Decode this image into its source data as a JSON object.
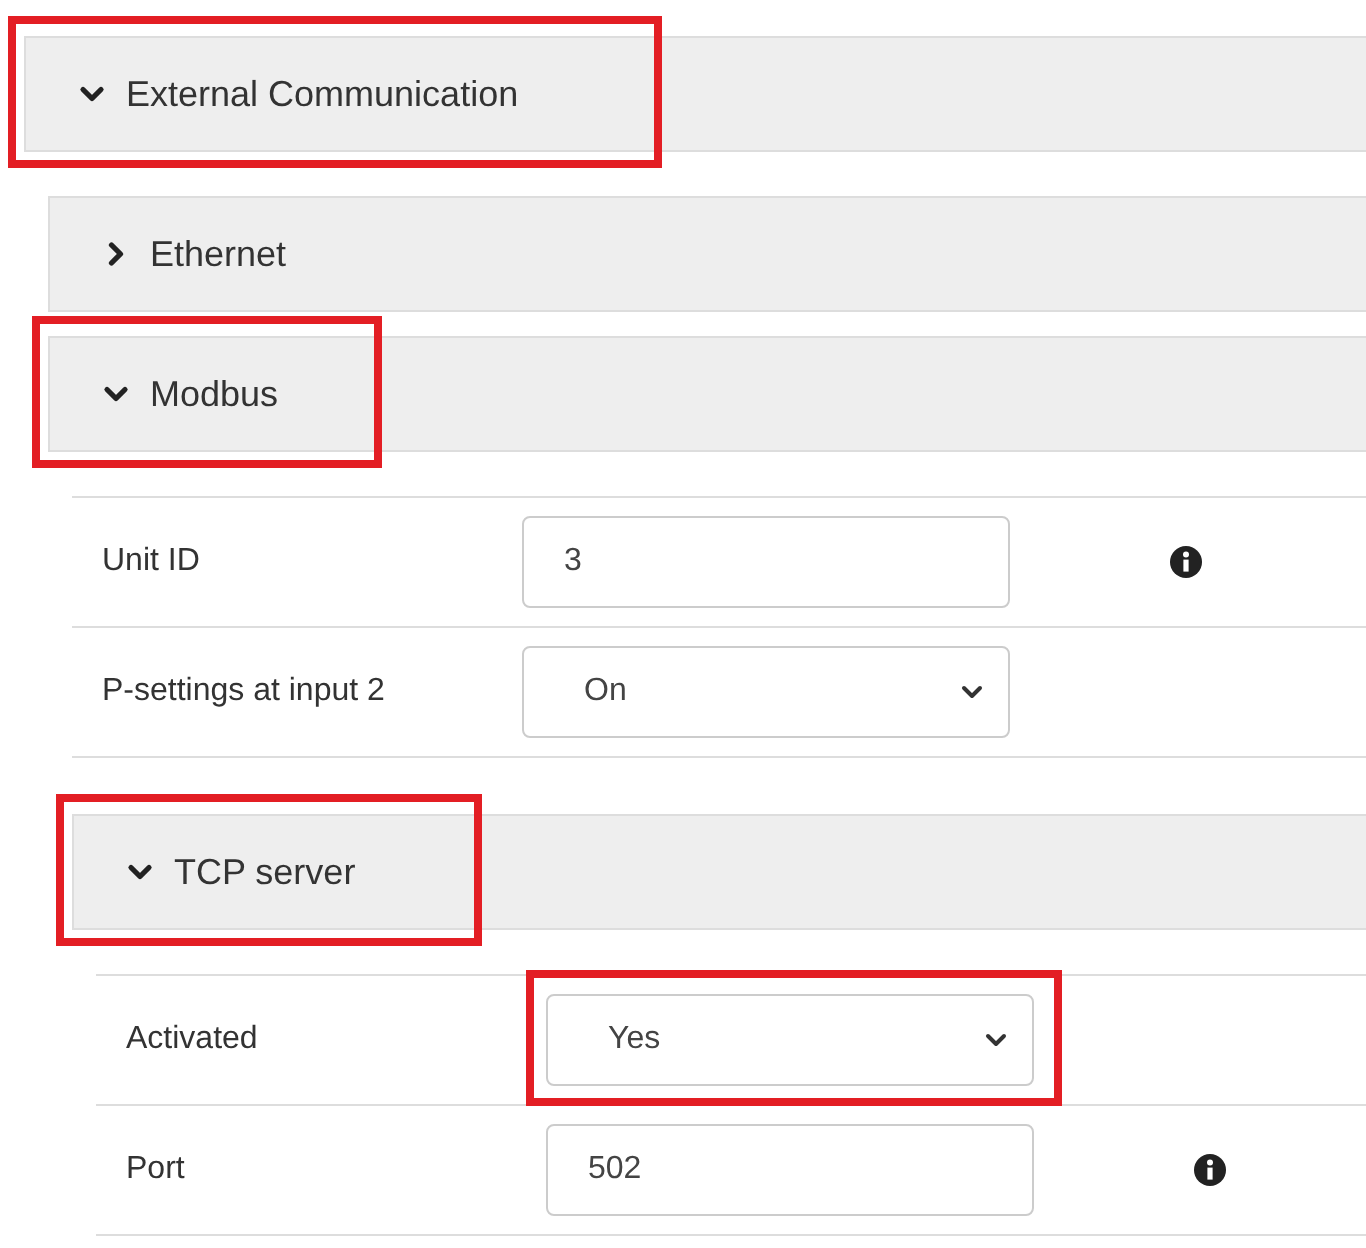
{
  "sections": [
    {
      "kind": "header",
      "title": "External Communication",
      "expanded": true,
      "highlighted": true,
      "children": [
        {
          "kind": "header",
          "title": "Ethernet",
          "expanded": false,
          "highlighted": false
        },
        {
          "kind": "header",
          "title": "Modbus",
          "expanded": true,
          "highlighted": true,
          "children": [
            {
              "kind": "input",
              "label": "Unit ID",
              "value": "3",
              "info": true,
              "highlighted": false
            },
            {
              "kind": "select",
              "label": "P-settings at input 2",
              "value": "On",
              "info": false,
              "highlighted": false
            },
            {
              "kind": "header",
              "title": "TCP server",
              "expanded": true,
              "highlighted": true,
              "children": [
                {
                  "kind": "select",
                  "label": "Activated",
                  "value": "Yes",
                  "info": false,
                  "highlighted": true
                },
                {
                  "kind": "input",
                  "label": "Port",
                  "value": "502",
                  "info": true,
                  "highlighted": false
                }
              ]
            }
          ]
        }
      ]
    }
  ]
}
